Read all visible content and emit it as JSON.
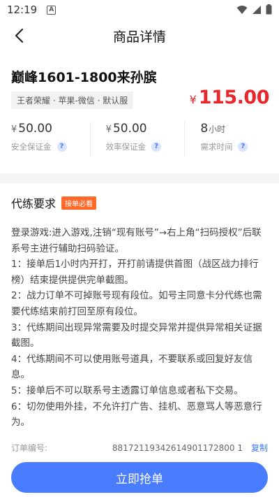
{
  "status_bar": {
    "time": "12:19",
    "notification_letter": "A"
  },
  "nav": {
    "title": "商品详情"
  },
  "product": {
    "name": "巅峰1601-1800来孙膑",
    "tag": "王者荣耀 · 苹果-微信 · 默认服",
    "price_symbol": "¥",
    "price": "115.00"
  },
  "stats": [
    {
      "symbol": "¥",
      "value": "50.00",
      "unit": "",
      "label": "安全保证金"
    },
    {
      "symbol": "¥",
      "value": "50.00",
      "unit": "",
      "label": "效率保证金"
    },
    {
      "symbol": "",
      "value": "8",
      "unit": "小时",
      "label": "需求时间"
    }
  ],
  "requirements": {
    "title": "代练要求",
    "badge": "接单必看",
    "lines": [
      "登录游戏:进入游戏,注销“现有账号”→右上角“扫码授权”后联系号主进行辅助扫码验证。",
      "1：接单后1小时内开打，开打前请提供首图（战区战力排行榜）结束提供提供完单截图。",
      "2：战力订单不可掉账号现有段位。如号主同意卡分代练也需要代练结束前打回至原有段位。",
      "3：代练期间出现异常需要及时提交异常并提供异常相关证据截图。",
      "4：代练期间不可以使用账号道具，不要联系或回复好友信息。",
      "5：接单后不可以联系号主透露订单信息或者私下交易。",
      "6：切勿使用外挂，不允许打广告、挂机、恶意骂人等恶意行为。"
    ]
  },
  "order": {
    "label": "订单编号:",
    "number": "88172119342614901172800 1",
    "copy_label": "复制"
  },
  "action": {
    "grab_label": "立即抢单"
  },
  "colors": {
    "accent": "#4a7cff",
    "price": "#e8262c",
    "badge": "#ff6a2b"
  }
}
